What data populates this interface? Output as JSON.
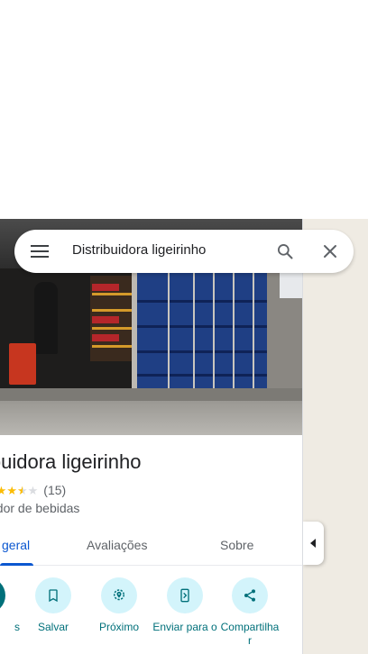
{
  "search": {
    "query": "Distribuidora ligeirinho"
  },
  "place": {
    "title": "ibuidora ligeirinho",
    "rating": 3.5,
    "rating_count": "(15)",
    "category": "edor de bebidas"
  },
  "tabs": [
    {
      "label": "geral",
      "active": true
    },
    {
      "label": "Avaliações",
      "active": false
    },
    {
      "label": "Sobre",
      "active": false
    }
  ],
  "actions": [
    {
      "label": "s",
      "icon": "directions-icon"
    },
    {
      "label": "Salvar",
      "icon": "bookmark-icon"
    },
    {
      "label": "Próximo",
      "icon": "nearby-icon"
    },
    {
      "label": "Enviar para o",
      "icon": "send-to-phone-icon"
    },
    {
      "label": "Compartilha r",
      "icon": "share-icon"
    }
  ],
  "colors": {
    "accent": "#0b57d0",
    "action_text": "#00707a",
    "action_bg": "#d3f4fb",
    "star": "#fbbc04"
  }
}
